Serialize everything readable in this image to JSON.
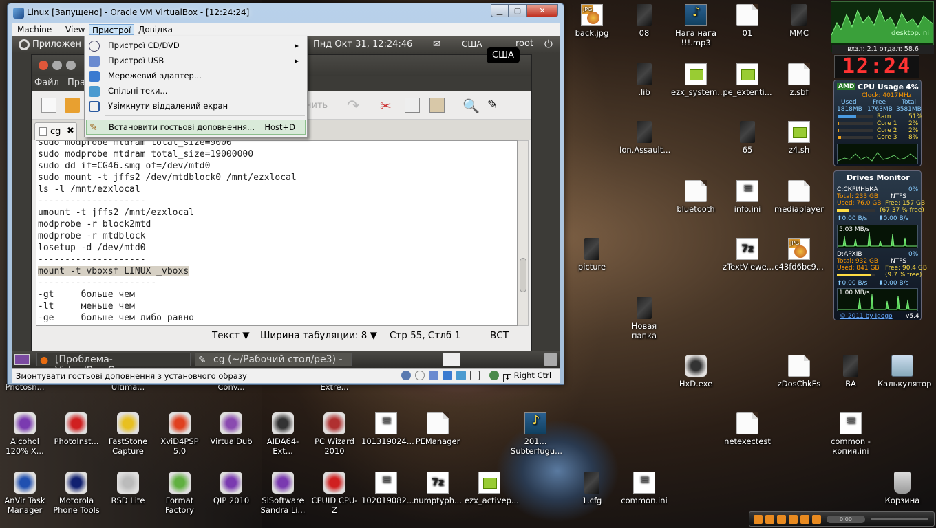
{
  "vbox": {
    "title": "Linux [Запущено] - Oracle VM VirtualBox - [12:24:24]",
    "menu": [
      "Machine",
      "View",
      "Пристрої",
      "Довідка"
    ],
    "status_text": "Змонтувати гостьові доповнення з установчого образу",
    "host_key": "Right Ctrl",
    "win_min": "▁",
    "win_max": "▢",
    "win_close": "✕"
  },
  "devices_menu": {
    "items": [
      {
        "label": "Пристрої CD/DVD",
        "submenu": "▸"
      },
      {
        "label": "Пристрої USB",
        "submenu": "▸"
      },
      {
        "label": "Мережевий адаптер...",
        "submenu": ""
      },
      {
        "label": "Спільні теки...",
        "submenu": ""
      },
      {
        "label": "Увімкнути віддалений екран",
        "submenu": ""
      }
    ],
    "guest_additions": {
      "label": "Встановити гостьові доповнення...",
      "shortcut": "Host+D"
    }
  },
  "gnome": {
    "apps": "Приложен",
    "clock": "Пнд Окт 31, 12:24:46",
    "kbd": "США",
    "user": "root",
    "tooltip": "США"
  },
  "gedit": {
    "menu": [
      "Файл",
      "Прав"
    ],
    "tab": "cg",
    "toolbar_ghost_label": "нить",
    "lines": [
      "sudo modprobe mtdram total_size=9000",
      "sudo modprobe mtdram total_size=19000000",
      "sudo dd if=CG46.smg of=/dev/mtd0",
      "sudo mount -t jffs2 /dev/mtdblock0 /mnt/ezxlocal",
      "ls -l /mnt/ezxlocal",
      "--------------------",
      "umount -t jffs2 /mnt/ezxlocal",
      "modprobe -r block2mtd",
      "modprobe -r mtdblock",
      "losetup -d /dev/mtd0",
      "--------------------",
      "mount -t vboxsf LINUX _vboxs",
      "----------------------",
      "-gt     больше чем",
      "-lt     меньше чем",
      "-ge     больше чем либо равно"
    ],
    "highlight_line": 11,
    "status": {
      "lang": "Текст ▼",
      "tab": "Ширина табуляции:  8 ▼",
      "pos": "Стр 55, Стлб 1",
      "mode": "ВСТ"
    }
  },
  "guest_taskbar": [
    "[Проблема-VirtualBox.Соз...",
    "cg (~/Рабочий стол/pe3) - ..."
  ],
  "desktop_icons": [
    {
      "label": "back.jpg",
      "kind": "jpg"
    },
    {
      "label": "08",
      "kind": "dark"
    },
    {
      "label": "Нага нага !!!.mp3",
      "kind": "mp3"
    },
    {
      "label": "01",
      "kind": "file"
    },
    {
      "label": "MMC",
      "kind": "dark"
    },
    {
      "label": ".lib",
      "kind": "dark"
    },
    {
      "label": "ezx_system....",
      "kind": "sh"
    },
    {
      "label": "pe_extenti...",
      "kind": "sh"
    },
    {
      "label": "z.sbf",
      "kind": "file"
    },
    {
      "label": "Ion.Assault...",
      "kind": "dark"
    },
    {
      "label": "65",
      "kind": "dark"
    },
    {
      "label": "z4.sh",
      "kind": "sh"
    },
    {
      "label": "bluetooth",
      "kind": "file"
    },
    {
      "label": "info.ini",
      "kind": "ini"
    },
    {
      "label": "mediaplayer",
      "kind": "file"
    },
    {
      "label": "picture",
      "kind": "dark"
    },
    {
      "label": "zTextViewe...",
      "kind": "z7"
    },
    {
      "label": "c43fd6bc9...",
      "kind": "jpg"
    },
    {
      "label": "Новая папка",
      "kind": "dark"
    },
    {
      "label": "HxD.exe",
      "kind": "app"
    },
    {
      "label": "zDosChkFs",
      "kind": "file"
    },
    {
      "label": "BA",
      "kind": "dark"
    },
    {
      "label": "Калькулятор",
      "kind": "calc"
    },
    {
      "label": "netexectest",
      "kind": "file"
    },
    {
      "label": "common - копия.ini",
      "kind": "ini"
    },
    {
      "label": "Photosh...",
      "kind": "app"
    },
    {
      "label": "Ultima...",
      "kind": "app"
    },
    {
      "label": "Conv...",
      "kind": "app"
    },
    {
      "label": "Extre...",
      "kind": "app"
    },
    {
      "label": "Alcohol 120% X...",
      "kind": "app"
    },
    {
      "label": "PhotoInst...",
      "kind": "app"
    },
    {
      "label": "FastStone Capture",
      "kind": "app"
    },
    {
      "label": "XviD4PSP 5.0",
      "kind": "app"
    },
    {
      "label": "VirtualDub",
      "kind": "app"
    },
    {
      "label": "AIDA64-Ext...",
      "kind": "app"
    },
    {
      "label": "PC Wizard 2010",
      "kind": "app"
    },
    {
      "label": "101319024...",
      "kind": "ini"
    },
    {
      "label": "PEManager",
      "kind": "file"
    },
    {
      "label": "201... Subterfugu...",
      "kind": "mp3"
    },
    {
      "label": "AnVir Task Manager",
      "kind": "app"
    },
    {
      "label": "Motorola Phone Tools",
      "kind": "app"
    },
    {
      "label": "RSD Lite",
      "kind": "app"
    },
    {
      "label": "Format Factory",
      "kind": "app"
    },
    {
      "label": "QIP 2010",
      "kind": "app"
    },
    {
      "label": "SiSoftware Sandra Li...",
      "kind": "app"
    },
    {
      "label": "CPUID CPU-Z",
      "kind": "app"
    },
    {
      "label": "102019082...",
      "kind": "ini"
    },
    {
      "label": "numptyph...",
      "kind": "z7"
    },
    {
      "label": "ezx_activep...",
      "kind": "sh"
    },
    {
      "label": "1.cfg",
      "kind": "dark"
    },
    {
      "label": "common.ini",
      "kind": "ini"
    },
    {
      "label": "Корзина",
      "kind": "trash"
    }
  ],
  "gadgets": {
    "top_label": "desktop.ini",
    "net": "вхзл: 2.1  отдал: 58.6",
    "digital": "12:24",
    "cpu": {
      "title": "CPU Usage",
      "pct": "4%",
      "brand": "AMD",
      "clock": "Clock: 4017MHz",
      "used_h": "Used",
      "free_h": "Free",
      "total_h": "Total",
      "used": "1818MB",
      "free": "1763MB",
      "total": "3581MB",
      "rows": [
        {
          "l": "Ram",
          "v": "51%",
          "f": 0.51
        },
        {
          "l": "Core 1",
          "v": "2%",
          "f": 0.02
        },
        {
          "l": "Core 2",
          "v": "2%",
          "f": 0.02
        },
        {
          "l": "Core 3",
          "v": "8%",
          "f": 0.08
        }
      ]
    },
    "drives": {
      "title": "Drives Monitor",
      "c_name": "C:СКРИНЬКА",
      "c_pct": "0%",
      "c_total": "Total: 233 GB",
      "c_fs": "NTFS",
      "c_used": "Used: 76.0 GB",
      "c_free": "Free: 157 GB",
      "c_freepct": "(67.37 % free)",
      "c_r": "⬆0.00 B/s",
      "c_w": "⬇0.00 B/s",
      "c_graph": "5.03 MB/s",
      "d_name": "D:АРХІВ",
      "d_pct": "0%",
      "d_total": "Total: 932 GB",
      "d_fs": "NTFS",
      "d_used": "Used: 841 GB",
      "d_free": "Free: 90.4 GB",
      "d_freepct": "(9.7 % free)",
      "d_r": "⬆0.00 B/s",
      "d_w": "⬇0.00 B/s",
      "d_graph": "1.00 MB/s",
      "footer": "© 2011 by Igogo",
      "ver": "v5.4"
    }
  },
  "player": {
    "time": "0:00"
  },
  "colors": {
    "accent": "#7aa7d6",
    "guest_bar": "#3c3b37",
    "highlight": "#d6d0c4"
  }
}
